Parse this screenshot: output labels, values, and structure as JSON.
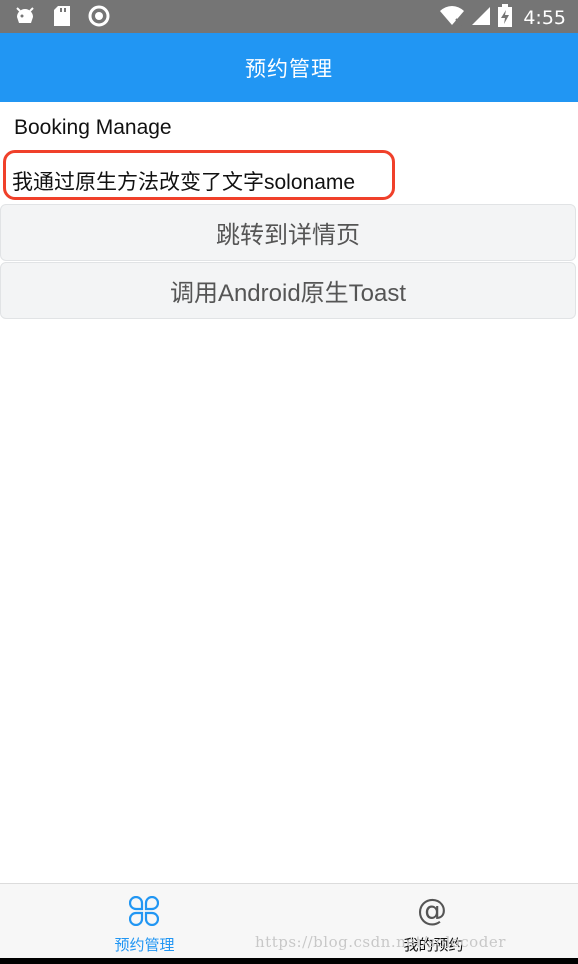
{
  "status_bar": {
    "time": "4:55",
    "icons": [
      "android-debug-icon",
      "sd-card-icon",
      "sync-circle-icon",
      "wifi-x-icon",
      "signal-icon",
      "battery-charging-icon"
    ]
  },
  "app_bar": {
    "title": "预约管理",
    "color": "#2196f3"
  },
  "content": {
    "line1": "Booking Manage",
    "line2": "我通过原生方法改变了文字soloname",
    "highlight_color": "#f0402a",
    "button1_label": "跳转到详情页",
    "button2_label": "调用Android原生Toast"
  },
  "tab_bar": {
    "tabs": [
      {
        "label": "预约管理",
        "icon": "four-petal-icon",
        "active": true
      },
      {
        "label": "我的预约",
        "icon": "at-sign-icon",
        "active": false
      }
    ],
    "active_color": "#2196f3"
  },
  "watermark": "https://blog.csdn.net/solocoder"
}
